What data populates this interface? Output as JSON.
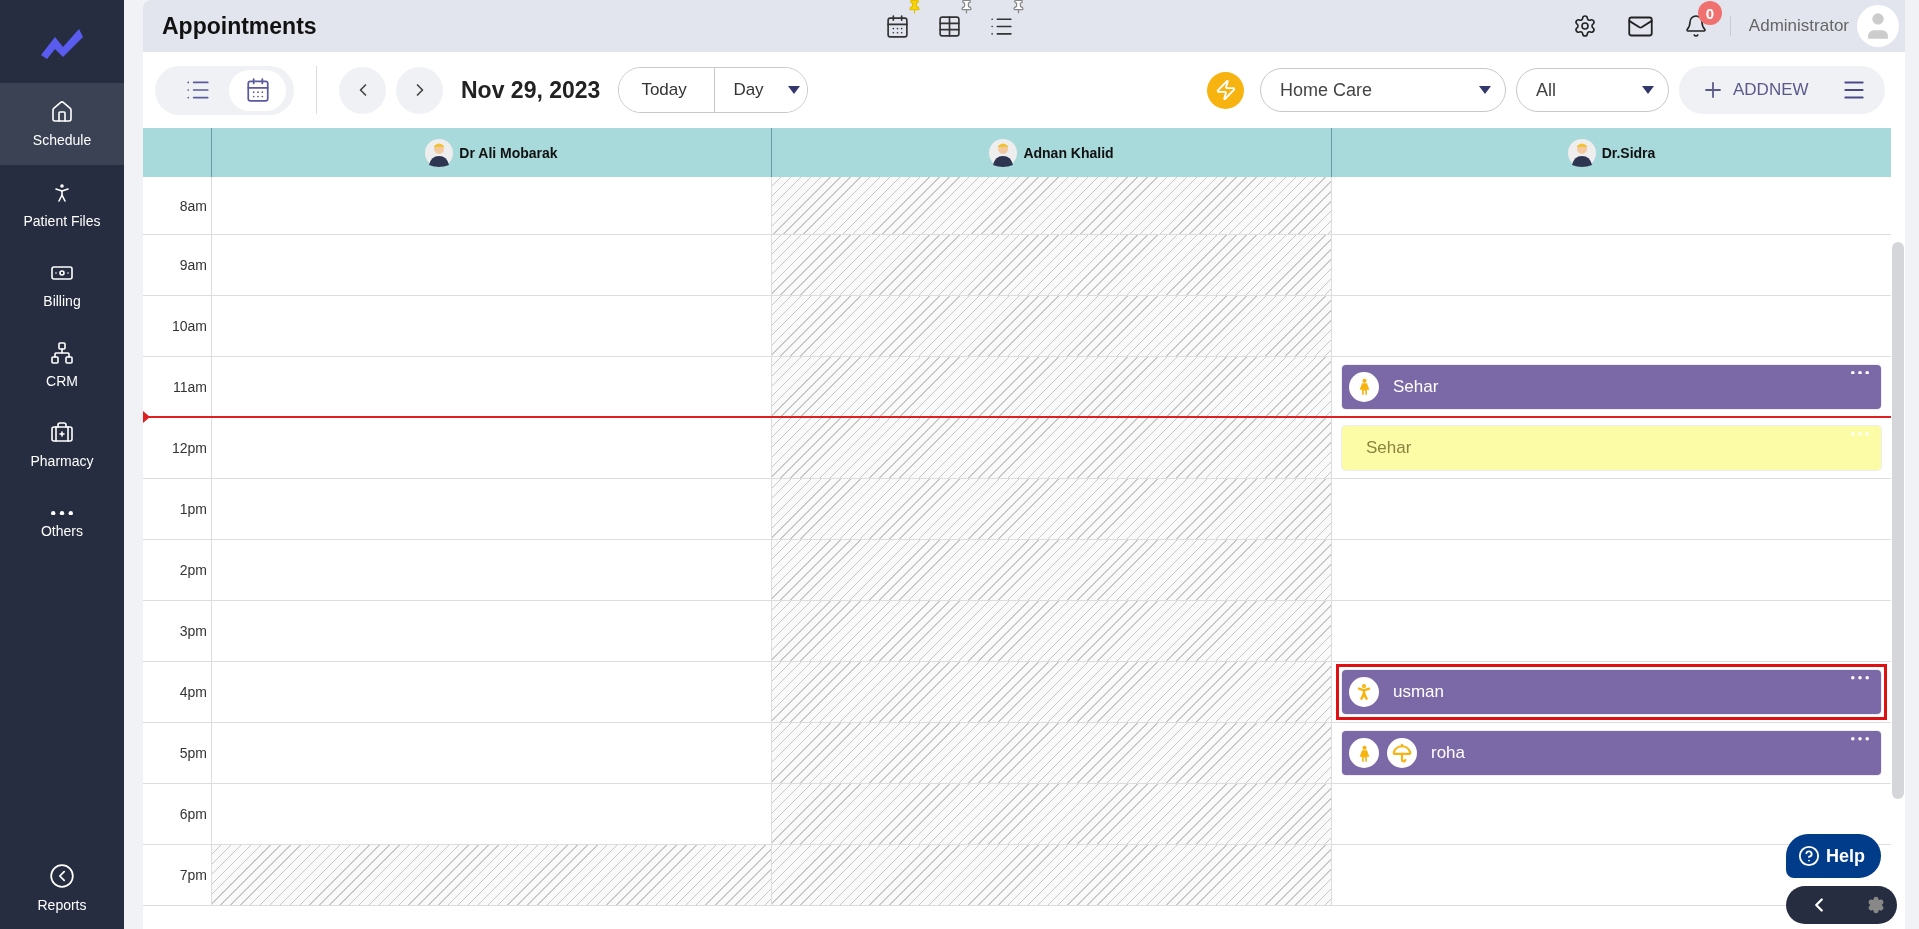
{
  "sidebar": {
    "items": [
      {
        "label": "Schedule",
        "selected": true
      },
      {
        "label": "Patient Files",
        "selected": false
      },
      {
        "label": "Billing",
        "selected": false
      },
      {
        "label": "CRM",
        "selected": false
      },
      {
        "label": "Pharmacy",
        "selected": false
      },
      {
        "label": "Others",
        "selected": false
      }
    ],
    "footer": {
      "label": "Reports"
    }
  },
  "header": {
    "title": "Appointments",
    "views": [
      {
        "selected": true
      },
      {
        "selected": false
      },
      {
        "selected": false
      }
    ],
    "notifications": "0",
    "user": "Administrator"
  },
  "toolbar": {
    "modes": [
      {
        "selected": false
      },
      {
        "selected": true
      }
    ],
    "date": "Nov 29, 2023",
    "today": "Today",
    "range": "Day",
    "department": "Home Care",
    "filter": "All",
    "add": "ADDNEW"
  },
  "resources": [
    {
      "name": "Dr Ali Mobarak"
    },
    {
      "name": "Adnan Khalid"
    },
    {
      "name": "Dr.Sidra"
    }
  ],
  "rows": [
    {
      "time": "8am",
      "current_time": false,
      "cells": [
        {
          "blocked": false
        },
        {
          "blocked": true
        },
        {
          "blocked": false
        }
      ]
    },
    {
      "time": "9am",
      "current_time": false,
      "cells": [
        {
          "blocked": false
        },
        {
          "blocked": true
        },
        {
          "blocked": false
        }
      ]
    },
    {
      "time": "10am",
      "current_time": false,
      "cells": [
        {
          "blocked": false
        },
        {
          "blocked": true
        },
        {
          "blocked": false
        }
      ]
    },
    {
      "time": "11am",
      "current_time": true,
      "cells": [
        {
          "blocked": false
        },
        {
          "blocked": true
        },
        {
          "blocked": false,
          "event": {
            "name": "Sehar",
            "color": "#7b68a6",
            "icons": [
              {
                "kind": "female"
              }
            ],
            "highlighted": false
          }
        }
      ]
    },
    {
      "time": "12pm",
      "current_time": false,
      "cells": [
        {
          "blocked": false
        },
        {
          "blocked": true
        },
        {
          "blocked": false,
          "event": {
            "name": "Sehar",
            "color": "#fdfca6",
            "highlighted": false
          }
        }
      ]
    },
    {
      "time": "1pm",
      "current_time": false,
      "cells": [
        {
          "blocked": false
        },
        {
          "blocked": true
        },
        {
          "blocked": false
        }
      ]
    },
    {
      "time": "2pm",
      "current_time": false,
      "cells": [
        {
          "blocked": false
        },
        {
          "blocked": true
        },
        {
          "blocked": false
        }
      ]
    },
    {
      "time": "3pm",
      "current_time": false,
      "cells": [
        {
          "blocked": false
        },
        {
          "blocked": true
        },
        {
          "blocked": false
        }
      ]
    },
    {
      "time": "4pm",
      "current_time": false,
      "cells": [
        {
          "blocked": false
        },
        {
          "blocked": true
        },
        {
          "blocked": false,
          "event": {
            "name": "usman",
            "color": "#7b68a6",
            "icons": [
              {
                "kind": "male"
              }
            ],
            "highlighted": true
          }
        }
      ]
    },
    {
      "time": "5pm",
      "current_time": false,
      "cells": [
        {
          "blocked": false
        },
        {
          "blocked": true
        },
        {
          "blocked": false,
          "event": {
            "name": "roha",
            "color": "#7b68a6",
            "icons": [
              {
                "kind": "female"
              },
              {
                "kind": "umbrella"
              }
            ],
            "highlighted": false
          }
        }
      ]
    },
    {
      "time": "6pm",
      "current_time": false,
      "cells": [
        {
          "blocked": false
        },
        {
          "blocked": true
        },
        {
          "blocked": false
        }
      ]
    },
    {
      "time": "7pm",
      "current_time": false,
      "cells": [
        {
          "blocked": true
        },
        {
          "blocked": true
        },
        {
          "blocked": false
        }
      ]
    }
  ],
  "help": {
    "label": "Help"
  }
}
